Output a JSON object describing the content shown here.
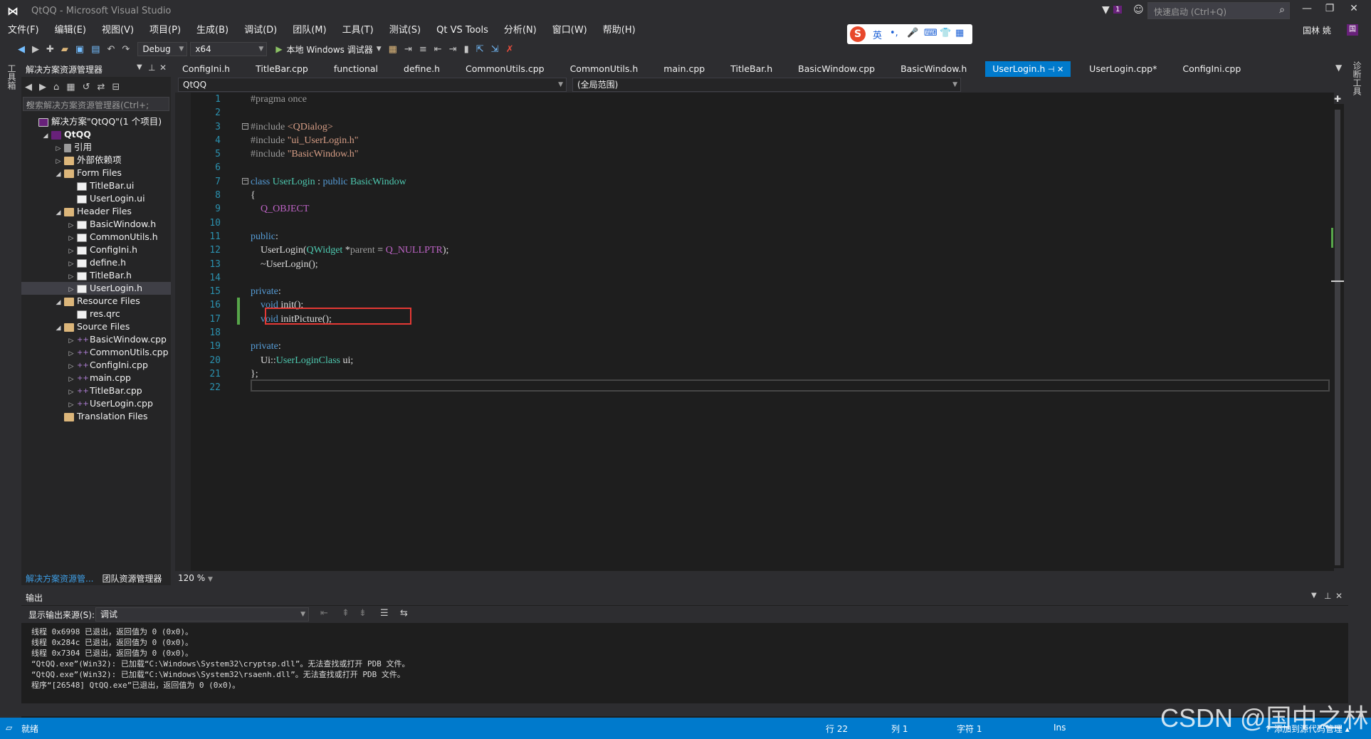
{
  "window": {
    "title": "QtQQ - Microsoft Visual Studio",
    "quick_launch_placeholder": "快速启动 (Ctrl+Q)",
    "notification_count": "1",
    "user_name": "国林 姚",
    "user_initials": "国"
  },
  "menu": [
    "文件(F)",
    "编辑(E)",
    "视图(V)",
    "项目(P)",
    "生成(B)",
    "调试(D)",
    "团队(M)",
    "工具(T)",
    "测试(S)",
    "Qt VS Tools",
    "分析(N)",
    "窗口(W)",
    "帮助(H)"
  ],
  "ime": {
    "lang": "英"
  },
  "toolbar": {
    "config": "Debug",
    "platform": "x64",
    "run_label": "本地 Windows 调试器"
  },
  "left_strip": {
    "label": "工具箱"
  },
  "right_strip": {
    "label": "诊断工具"
  },
  "solution_explorer": {
    "title": "解决方案资源管理器",
    "search_placeholder": "搜索解决方案资源管理器(Ctrl+;",
    "tree": [
      {
        "label": "解决方案\"QtQQ\"(1 个项目)",
        "depth": 0,
        "icon": "sol",
        "twisty": ""
      },
      {
        "label": "QtQQ",
        "depth": 1,
        "icon": "proj",
        "twisty": "◢",
        "bold": true
      },
      {
        "label": "引用",
        "depth": 2,
        "icon": "ref",
        "twisty": "▷"
      },
      {
        "label": "外部依赖项",
        "depth": 2,
        "icon": "folder",
        "twisty": "▷"
      },
      {
        "label": "Form Files",
        "depth": 2,
        "icon": "folder",
        "twisty": "◢"
      },
      {
        "label": "TitleBar.ui",
        "depth": 3,
        "icon": "file",
        "twisty": ""
      },
      {
        "label": "UserLogin.ui",
        "depth": 3,
        "icon": "file",
        "twisty": ""
      },
      {
        "label": "Header Files",
        "depth": 2,
        "icon": "folder",
        "twisty": "◢"
      },
      {
        "label": "BasicWindow.h",
        "depth": 3,
        "icon": "file",
        "twisty": "▷"
      },
      {
        "label": "CommonUtils.h",
        "depth": 3,
        "icon": "file",
        "twisty": "▷"
      },
      {
        "label": "ConfigIni.h",
        "depth": 3,
        "icon": "file",
        "twisty": "▷"
      },
      {
        "label": "define.h",
        "depth": 3,
        "icon": "file",
        "twisty": "▷"
      },
      {
        "label": "TitleBar.h",
        "depth": 3,
        "icon": "file",
        "twisty": "▷"
      },
      {
        "label": "UserLogin.h",
        "depth": 3,
        "icon": "file",
        "twisty": "▷",
        "selected": true
      },
      {
        "label": "Resource Files",
        "depth": 2,
        "icon": "folder",
        "twisty": "◢"
      },
      {
        "label": "res.qrc",
        "depth": 3,
        "icon": "file",
        "twisty": ""
      },
      {
        "label": "Source Files",
        "depth": 2,
        "icon": "folder",
        "twisty": "◢"
      },
      {
        "label": "BasicWindow.cpp",
        "depth": 3,
        "icon": "cpp",
        "twisty": "▷"
      },
      {
        "label": "CommonUtils.cpp",
        "depth": 3,
        "icon": "cpp",
        "twisty": "▷"
      },
      {
        "label": "ConfigIni.cpp",
        "depth": 3,
        "icon": "cpp",
        "twisty": "▷"
      },
      {
        "label": "main.cpp",
        "depth": 3,
        "icon": "cpp",
        "twisty": "▷"
      },
      {
        "label": "TitleBar.cpp",
        "depth": 3,
        "icon": "cpp",
        "twisty": "▷"
      },
      {
        "label": "UserLogin.cpp",
        "depth": 3,
        "icon": "cpp",
        "twisty": "▷"
      },
      {
        "label": "Translation Files",
        "depth": 2,
        "icon": "folder",
        "twisty": ""
      }
    ],
    "bottom_tabs": [
      "解决方案资源管...",
      "团队资源管理器"
    ]
  },
  "editor": {
    "tabs": [
      {
        "label": "ConfigIni.h",
        "active": false
      },
      {
        "label": "TitleBar.cpp",
        "active": false
      },
      {
        "label": "functional",
        "active": false
      },
      {
        "label": "define.h",
        "active": false
      },
      {
        "label": "CommonUtils.cpp",
        "active": false
      },
      {
        "label": "CommonUtils.h",
        "active": false
      },
      {
        "label": "main.cpp",
        "active": false
      },
      {
        "label": "TitleBar.h",
        "active": false
      },
      {
        "label": "BasicWindow.cpp",
        "active": false
      },
      {
        "label": "BasicWindow.h",
        "active": false
      },
      {
        "label": "UserLogin.h",
        "active": true
      },
      {
        "label": "UserLogin.cpp*",
        "active": false
      },
      {
        "label": "ConfigIni.cpp",
        "active": false
      }
    ],
    "nav_project": "QtQQ",
    "nav_scope": "(全局范围)",
    "zoom": "120 %",
    "code_lines": [
      [
        {
          "t": "#pragma once",
          "c": "pp"
        }
      ],
      [],
      [
        {
          "t": "#include ",
          "c": "pp"
        },
        {
          "t": "<QDialog>",
          "c": "str"
        }
      ],
      [
        {
          "t": "#include ",
          "c": "pp"
        },
        {
          "t": "\"ui_UserLogin.h\"",
          "c": "str"
        }
      ],
      [
        {
          "t": "#include ",
          "c": "pp"
        },
        {
          "t": "\"BasicWindow.h\"",
          "c": "str"
        }
      ],
      [],
      [
        {
          "t": "class ",
          "c": "kw"
        },
        {
          "t": "UserLogin",
          "c": "ty"
        },
        {
          "t": " : ",
          "c": ""
        },
        {
          "t": "public ",
          "c": "kw"
        },
        {
          "t": "BasicWindow",
          "c": "ty"
        }
      ],
      [
        {
          "t": "{",
          "c": ""
        }
      ],
      [
        {
          "t": "    ",
          "c": ""
        },
        {
          "t": "Q_OBJECT",
          "c": "mac"
        }
      ],
      [],
      [
        {
          "t": "public",
          "c": "kw"
        },
        {
          "t": ":",
          "c": ""
        }
      ],
      [
        {
          "t": "    UserLogin(",
          "c": ""
        },
        {
          "t": "QWidget",
          "c": "ty"
        },
        {
          "t": " *",
          "c": ""
        },
        {
          "t": "parent",
          "c": "pp"
        },
        {
          "t": " = ",
          "c": ""
        },
        {
          "t": "Q_NULLPTR",
          "c": "mac"
        },
        {
          "t": ");",
          "c": ""
        }
      ],
      [
        {
          "t": "    ~UserLogin();",
          "c": ""
        }
      ],
      [],
      [
        {
          "t": "private",
          "c": "kw"
        },
        {
          "t": ":",
          "c": ""
        }
      ],
      [
        {
          "t": "    ",
          "c": ""
        },
        {
          "t": "void ",
          "c": "kw"
        },
        {
          "t": "init();",
          "c": ""
        }
      ],
      [
        {
          "t": "    ",
          "c": ""
        },
        {
          "t": "void ",
          "c": "kw"
        },
        {
          "t": "initPicture();",
          "c": ""
        }
      ],
      [],
      [
        {
          "t": "private",
          "c": "kw"
        },
        {
          "t": ":",
          "c": ""
        }
      ],
      [
        {
          "t": "    Ui::",
          "c": ""
        },
        {
          "t": "UserLoginClass",
          "c": "ty"
        },
        {
          "t": " ui;",
          "c": ""
        }
      ],
      [
        {
          "t": "};",
          "c": ""
        }
      ],
      []
    ]
  },
  "output": {
    "title": "输出",
    "source_label": "显示输出来源(S):",
    "source_value": "调试",
    "lines": [
      "线程 0x6998 已退出，返回值为 0 (0x0)。",
      "线程 0x284c 已退出，返回值为 0 (0x0)。",
      "线程 0x7304 已退出，返回值为 0 (0x0)。",
      "“QtQQ.exe”(Win32): 已加载“C:\\Windows\\System32\\cryptsp.dll”。无法查找或打开 PDB 文件。",
      "“QtQQ.exe”(Win32): 已加载“C:\\Windows\\System32\\rsaenh.dll”。无法查找或打开 PDB 文件。",
      "程序“[26548] QtQQ.exe”已退出，返回值为 0 (0x0)。"
    ]
  },
  "status": {
    "ready": "就绪",
    "line": "行 22",
    "col": "列 1",
    "char": "字符 1",
    "mode": "Ins",
    "source_control": "↑ 添加到源代码管理 ▴"
  },
  "watermark": "CSDN @国中之林",
  "colors": {
    "accent": "#007acc",
    "highlight_box": "#e53935",
    "keyword": "#569cd6",
    "type": "#4ec9b0",
    "string": "#d69d85",
    "macro": "#bd63c5"
  }
}
